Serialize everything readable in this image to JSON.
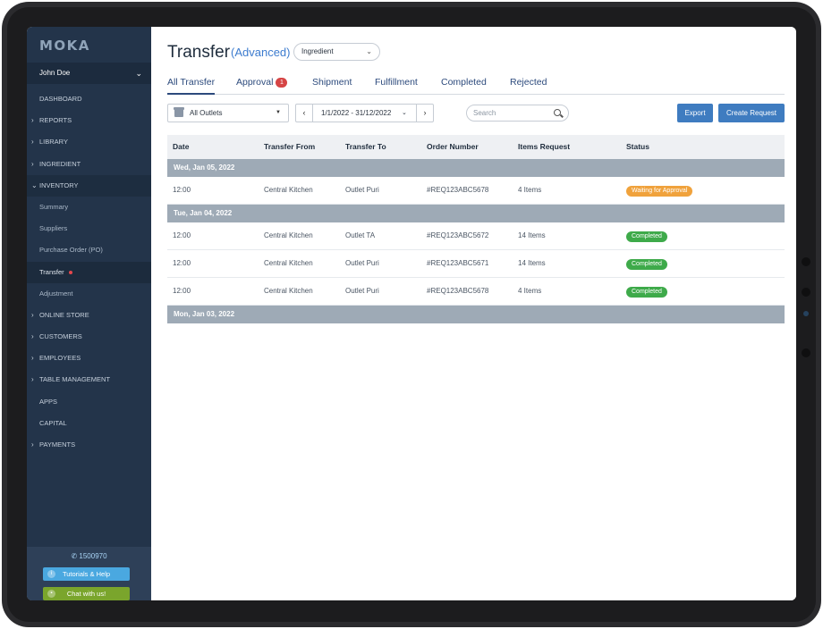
{
  "sidebar": {
    "logo": "MOKA",
    "user": "John Doe",
    "items": [
      {
        "label": "DASHBOARD",
        "caret": ""
      },
      {
        "label": "REPORTS",
        "caret": "›"
      },
      {
        "label": "LIBRARY",
        "caret": "›"
      },
      {
        "label": "INGREDIENT",
        "caret": "›"
      },
      {
        "label": "INVENTORY",
        "caret": "⌄"
      }
    ],
    "inventory_sub": [
      "Summary",
      "Suppliers",
      "Purchase Order (PO)",
      "Transfer",
      "Adjustment"
    ],
    "items_after": [
      {
        "label": "ONLINE STORE",
        "caret": "›"
      },
      {
        "label": "CUSTOMERS",
        "caret": "›"
      },
      {
        "label": "EMPLOYEES",
        "caret": "›"
      },
      {
        "label": "TABLE MANAGEMENT",
        "caret": "›"
      },
      {
        "label": "APPS",
        "caret": ""
      },
      {
        "label": "CAPITAL",
        "caret": ""
      },
      {
        "label": "PAYMENTS",
        "caret": "›"
      }
    ],
    "phone": "1500970",
    "help_label": "Tutorials & Help",
    "chat_label": "Chat with us!"
  },
  "header": {
    "title": "Transfer",
    "subtitle": "(Advanced)",
    "type_select": "Ingredient"
  },
  "tabs": [
    {
      "label": "All Transfer"
    },
    {
      "label": "Approval",
      "badge": "1"
    },
    {
      "label": "Shipment"
    },
    {
      "label": "Fulfillment"
    },
    {
      "label": "Completed"
    },
    {
      "label": "Rejected"
    }
  ],
  "filters": {
    "outlet": "All Outlets",
    "date_range": "1/1/2022 - 31/12/2022",
    "search_placeholder": "Search",
    "export_label": "Export",
    "create_label": "Create Request"
  },
  "table": {
    "columns": [
      "Date",
      "Transfer From",
      "Transfer To",
      "Order Number",
      "Items Request",
      "Status"
    ],
    "groups": [
      {
        "label": "Wed, Jan 05, 2022",
        "rows": [
          {
            "time": "12:00",
            "from": "Central Kitchen",
            "to": "Outlet Puri",
            "order": "#REQ123ABC5678",
            "items": "4 Items",
            "status": "Waiting for Approval"
          }
        ]
      },
      {
        "label": "Tue, Jan 04, 2022",
        "rows": [
          {
            "time": "12:00",
            "from": "Central Kitchen",
            "to": "Outlet TA",
            "order": "#REQ123ABC5672",
            "items": "14 Items",
            "status": "Completed"
          },
          {
            "time": "12:00",
            "from": "Central Kitchen",
            "to": "Outlet Puri",
            "order": "#REQ123ABC5671",
            "items": "14 Items",
            "status": "Completed"
          },
          {
            "time": "12:00",
            "from": "Central Kitchen",
            "to": "Outlet Puri",
            "order": "#REQ123ABC5678",
            "items": "4 Items",
            "status": "Completed"
          }
        ]
      },
      {
        "label": "Mon, Jan 03, 2022",
        "rows": []
      }
    ]
  },
  "colors": {
    "sidebar": "#23344a",
    "accent": "#3f7cc0",
    "waiting": "#f0a23c",
    "completed": "#3eaa4a"
  }
}
